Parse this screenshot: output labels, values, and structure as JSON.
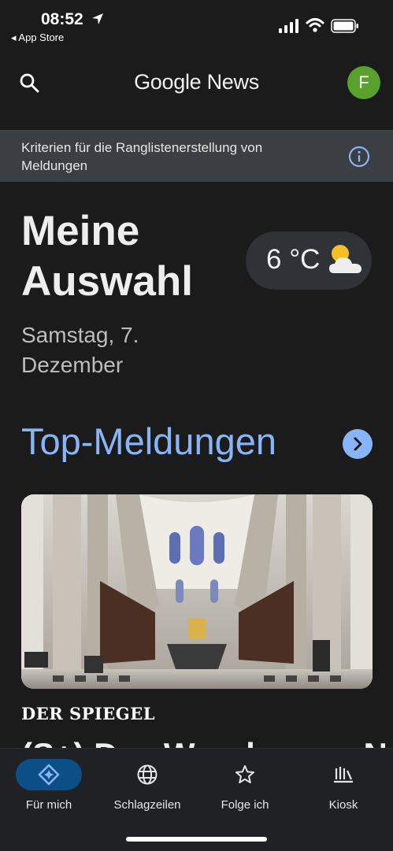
{
  "status_bar": {
    "time": "08:52",
    "back_app": "◂ App Store"
  },
  "header": {
    "logo": "Google News",
    "avatar_letter": "F",
    "avatar_color": "#5aa02c"
  },
  "banner": {
    "text": "Kriterien für die Ranglistenerstellung von Meldungen",
    "icon": "info-icon"
  },
  "hero": {
    "title": "Meine Auswahl",
    "date": "Samstag, 7. Dezember"
  },
  "weather": {
    "temperature": "6 °C",
    "icon": "partly-cloudy-icon"
  },
  "top_stories": {
    "title": "Top-Meldungen",
    "accent_color": "#8ab4f8",
    "article": {
      "source": "DER SPIEGEL",
      "headline_cut": "(S+) Das Wunder von N"
    }
  },
  "bottom_nav": {
    "items": [
      {
        "label": "Für mich",
        "icon": "for-you-icon",
        "active": true
      },
      {
        "label": "Schlagzeilen",
        "icon": "globe-icon",
        "active": false
      },
      {
        "label": "Folge ich",
        "icon": "star-icon",
        "active": false
      },
      {
        "label": "Kiosk",
        "icon": "newsstand-icon",
        "active": false
      }
    ]
  }
}
